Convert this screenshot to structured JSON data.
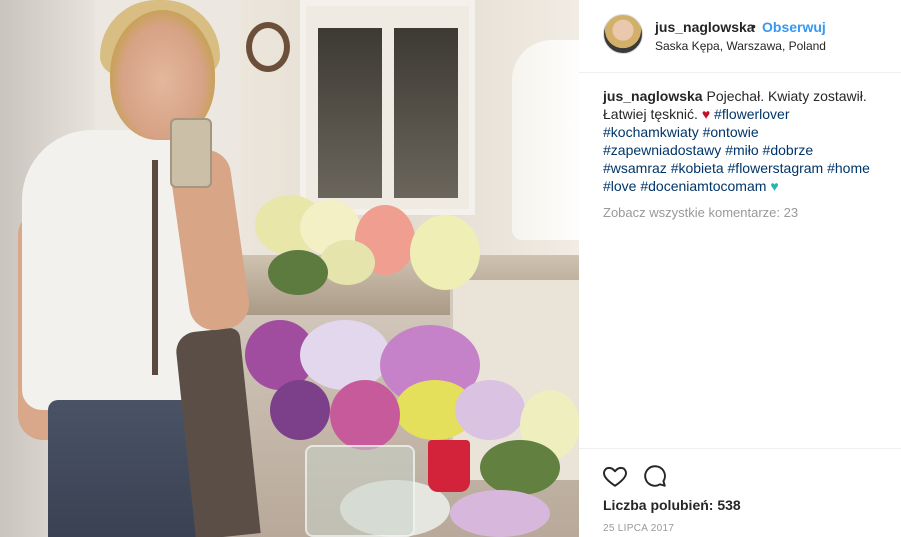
{
  "post": {
    "author": {
      "username": "jus_naglowska",
      "separator": "•",
      "follow_label": "Obserwuj",
      "location": "Saska Kępa, Warszawa, Poland"
    },
    "caption": {
      "username": "jus_naglowska",
      "text": "Pojechał. Kwiaty zostawił. Łatwiej tęsknić.",
      "tags_line1": [
        "#flowerlover",
        "#kochamkwiaty",
        "#ontowie",
        "#zapewniadostawy",
        "#miło",
        "#dobrze"
      ],
      "tags_line2": [
        "#wsamraz",
        "#kobieta",
        "#flowerstagram",
        "#home",
        "#love",
        "#doceniamtocomam"
      ]
    },
    "view_comments": "Zobacz wszystkie komentarze: 23",
    "likes": "Liczba polubień: 538",
    "date": "25 LIPCA 2017"
  },
  "icons": {
    "like": "heart-outline-icon",
    "comment": "speech-bubble-icon",
    "caption_emoji_1": "red-heart-emoji",
    "caption_emoji_2": "teal-heart-emoji"
  },
  "colors": {
    "link_blue": "#3897f0",
    "hashtag": "#003569",
    "muted": "#999999",
    "text": "#262626"
  }
}
